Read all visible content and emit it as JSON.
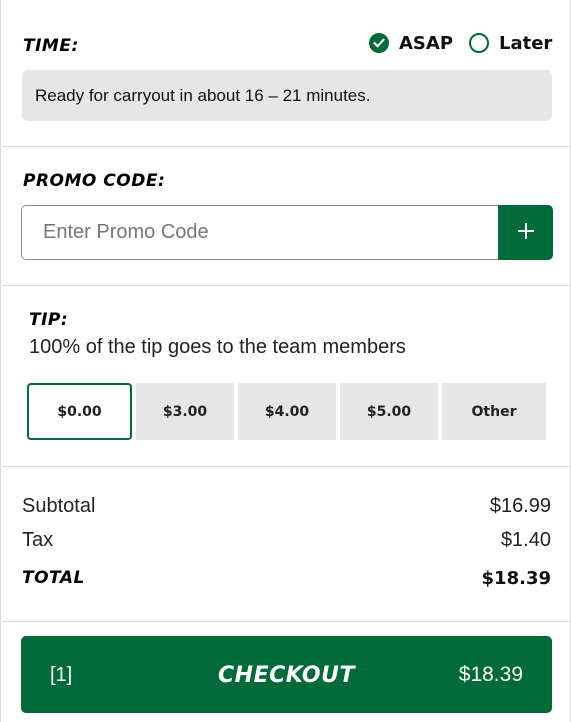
{
  "time": {
    "heading": "TIME:",
    "options": [
      {
        "label": "ASAP",
        "selected": true
      },
      {
        "label": "Later",
        "selected": false
      }
    ],
    "ready_text": "Ready for carryout in about 16 – 21 minutes."
  },
  "promo": {
    "heading": "PROMO CODE:",
    "placeholder": "Enter Promo Code",
    "value": "",
    "add_icon": "plus-icon"
  },
  "tip": {
    "heading": "TIP:",
    "description": "100% of the tip goes to the team members",
    "options": [
      {
        "label": "$0.00",
        "selected": true
      },
      {
        "label": "$3.00",
        "selected": false
      },
      {
        "label": "$4.00",
        "selected": false
      },
      {
        "label": "$5.00",
        "selected": false
      },
      {
        "label": "Other",
        "selected": false
      }
    ]
  },
  "totals": {
    "subtotal_label": "Subtotal",
    "subtotal_value": "$16.99",
    "tax_label": "Tax",
    "tax_value": "$1.40",
    "total_label": "TOTAL",
    "total_value": "$18.39"
  },
  "checkout": {
    "count": "[1]",
    "label": "CHECKOUT",
    "price": "$18.39"
  },
  "colors": {
    "brand_green": "#006b38",
    "panel_gray": "#e6e6e6",
    "divider": "#dcdcdc"
  }
}
